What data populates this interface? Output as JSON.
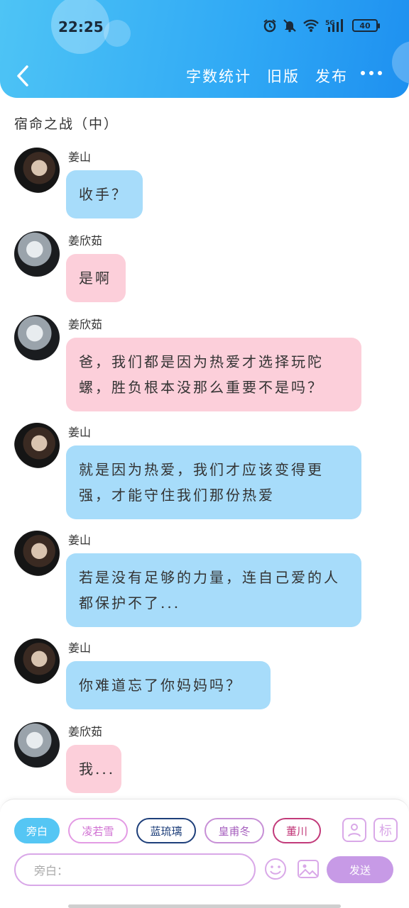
{
  "status_bar": {
    "time": "22:25",
    "battery": "40",
    "network": "5G"
  },
  "header": {
    "actions": [
      "字数统计",
      "旧版",
      "发布"
    ]
  },
  "chapter_title": "宿命之战（中）",
  "messages": [
    {
      "sender": "姜山",
      "avatar": "man",
      "bubble": "blue",
      "text": "收手？"
    },
    {
      "sender": "姜欣茹",
      "avatar": "girl",
      "bubble": "pink",
      "text": "是啊"
    },
    {
      "sender": "姜欣茹",
      "avatar": "girl",
      "bubble": "pink",
      "text": "爸，我们都是因为热爱才选择玩陀螺，胜负根本没那么重要不是吗？"
    },
    {
      "sender": "姜山",
      "avatar": "man",
      "bubble": "blue",
      "text": "就是因为热爱，我们才应该变得更强，才能守住我们那份热爱"
    },
    {
      "sender": "姜山",
      "avatar": "man",
      "bubble": "blue",
      "text": "若是没有足够的力量，连自己爱的人都保护不了..."
    },
    {
      "sender": "姜山",
      "avatar": "man",
      "bubble": "blue",
      "text": "你难道忘了你妈妈吗？"
    },
    {
      "sender": "姜欣茹",
      "avatar": "girl",
      "bubble": "pink",
      "text": "我..."
    }
  ],
  "composer": {
    "characters": [
      "旁白",
      "凌若雪",
      "蓝琉璃",
      "皇甫冬",
      "董川"
    ],
    "selected_character": "旁白",
    "input_placeholder": "旁白：",
    "tag_icon_label": "标",
    "send_label": "发送"
  },
  "colors": {
    "header_gradient": [
      "#4ec4f5",
      "#1e90f0"
    ],
    "bubble_blue": "#a7dcfa",
    "bubble_pink": "#fccfda",
    "send_button": "#c79ae6"
  }
}
